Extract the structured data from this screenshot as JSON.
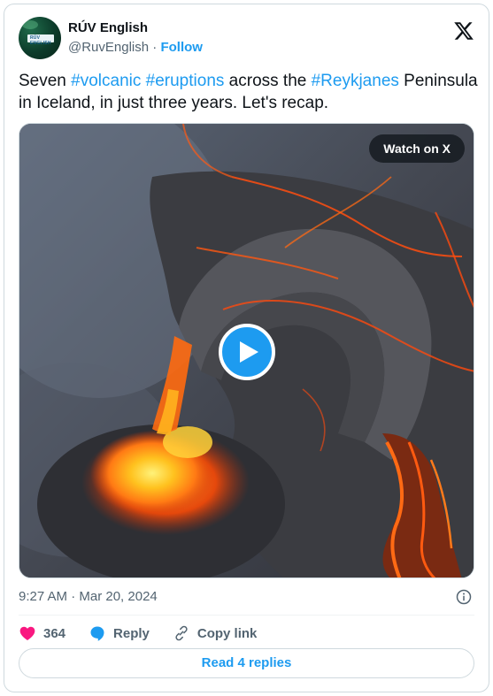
{
  "author": {
    "name": "RÚV English",
    "handle": "@RuvEnglish",
    "separator": " · ",
    "follow_label": "Follow",
    "avatar_tag_text": "RÚV ENGLISH"
  },
  "tweet": {
    "segments": [
      {
        "text": "Seven ",
        "type": "text"
      },
      {
        "text": "#volcanic",
        "type": "hashtag"
      },
      {
        "text": " ",
        "type": "text"
      },
      {
        "text": "#eruptions",
        "type": "hashtag"
      },
      {
        "text": " across the ",
        "type": "text"
      },
      {
        "text": "#Reykjanes",
        "type": "hashtag"
      },
      {
        "text": " Peninsula in Iceland, in just three years. Let's recap.",
        "type": "text"
      }
    ]
  },
  "media": {
    "watch_label": "Watch on X",
    "play_icon": "play-icon"
  },
  "meta": {
    "timestamp": "9:27 AM · Mar 20, 2024",
    "info_icon": "info-icon"
  },
  "actions": {
    "like_count": "364",
    "reply_label": "Reply",
    "copy_link_label": "Copy link"
  },
  "replies": {
    "label": "Read 4 replies"
  },
  "colors": {
    "accent": "#1d9bf0",
    "like": "#f91880",
    "text_primary": "#0f1419",
    "text_secondary": "#536471",
    "border": "#cfd9de"
  }
}
